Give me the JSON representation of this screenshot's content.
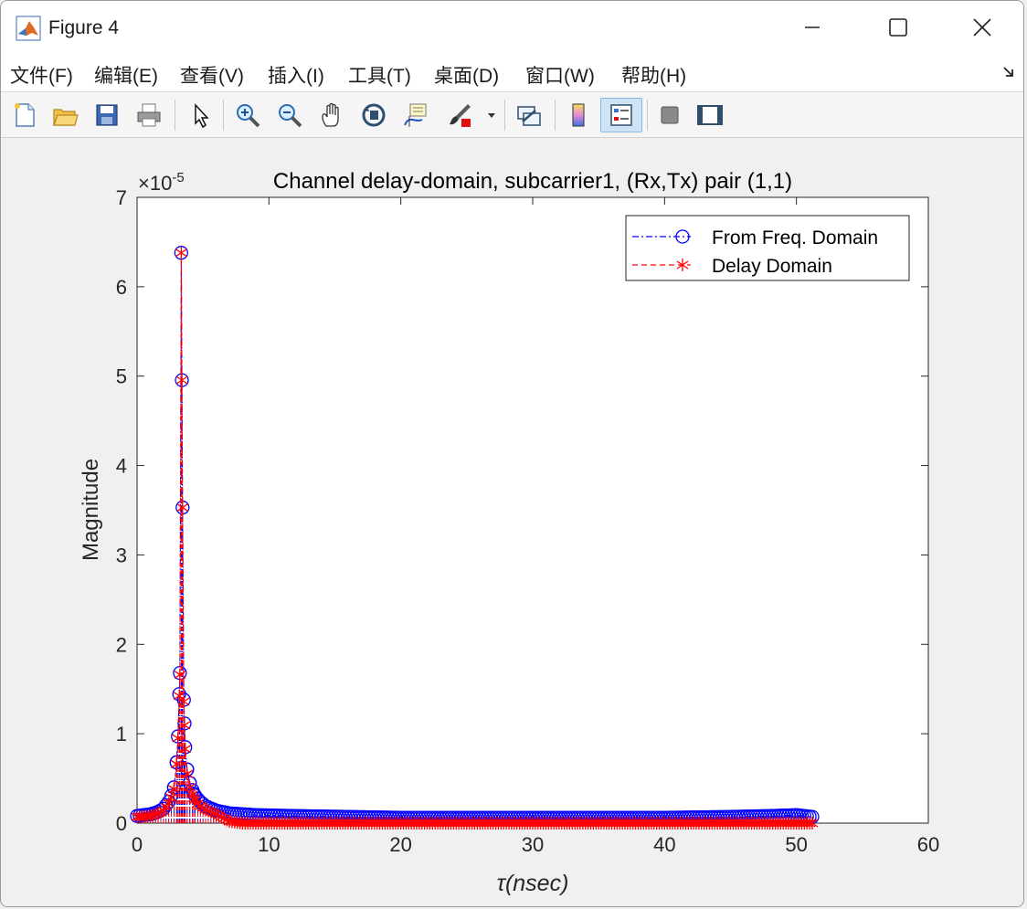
{
  "window": {
    "title": "Figure 4"
  },
  "menu": {
    "items": [
      {
        "label": "文件(F)",
        "name": "menu-file"
      },
      {
        "label": "编辑(E)",
        "name": "menu-edit"
      },
      {
        "label": "查看(V)",
        "name": "menu-view"
      },
      {
        "label": "插入(I)",
        "name": "menu-insert"
      },
      {
        "label": "工具(T)",
        "name": "menu-tools"
      },
      {
        "label": "桌面(D)",
        "name": "menu-desktop"
      },
      {
        "label": "窗口(W)",
        "name": "menu-window"
      },
      {
        "label": "帮助(H)",
        "name": "menu-help"
      }
    ]
  },
  "toolbar": {
    "icons": [
      "new-figure-icon",
      "open-file-icon",
      "save-icon",
      "print-icon",
      "select-arrow-icon",
      "zoom-in-icon",
      "zoom-out-icon",
      "pan-hand-icon",
      "rotate-3d-icon",
      "data-cursor-icon",
      "brush-icon",
      "brush-dropdown-icon",
      "link-plot-icon",
      "colorbar-icon",
      "legend-icon",
      "hide-plot-tools-icon",
      "show-plot-tools-icon"
    ]
  },
  "chart_data": {
    "type": "line",
    "title": "Channel delay-domain, subcarrier1, (Rx,Tx) pair (1,1)",
    "exponent_label": "×10",
    "exponent_power": "-5",
    "xlabel": "τ(nsec)",
    "ylabel": "Magnitude",
    "xlim": [
      0,
      60
    ],
    "ylim": [
      0,
      7
    ],
    "xticks": [
      "0",
      "10",
      "20",
      "30",
      "40",
      "50",
      "60"
    ],
    "yticks": [
      "0",
      "1",
      "2",
      "3",
      "4",
      "5",
      "6",
      "7"
    ],
    "legend_position": "top-right",
    "series": [
      {
        "name": "From Freq. Domain",
        "color": "#0000ff",
        "linestyle": "dash-dot",
        "marker": "circle",
        "points": [
          [
            0,
            0.08
          ],
          [
            0.5,
            0.09
          ],
          [
            1,
            0.1
          ],
          [
            1.5,
            0.12
          ],
          [
            2,
            0.16
          ],
          [
            2.5,
            0.26
          ],
          [
            2.8,
            0.4
          ],
          [
            3.0,
            0.68
          ],
          [
            3.1,
            0.97
          ],
          [
            3.25,
            1.68
          ],
          [
            3.35,
            6.38
          ],
          [
            3.45,
            3.53
          ],
          [
            3.55,
            1.38
          ],
          [
            3.65,
            0.85
          ],
          [
            3.8,
            0.6
          ],
          [
            4.0,
            0.45
          ],
          [
            4.3,
            0.33
          ],
          [
            4.7,
            0.25
          ],
          [
            5.2,
            0.19
          ],
          [
            6,
            0.14
          ],
          [
            7,
            0.11
          ],
          [
            9,
            0.09
          ],
          [
            12,
            0.08
          ],
          [
            16,
            0.07
          ],
          [
            20,
            0.06
          ],
          [
            25,
            0.06
          ],
          [
            30,
            0.06
          ],
          [
            35,
            0.06
          ],
          [
            40,
            0.06
          ],
          [
            45,
            0.07
          ],
          [
            48,
            0.08
          ],
          [
            50,
            0.09
          ],
          [
            51.2,
            0.07
          ]
        ]
      },
      {
        "name": "Delay Domain",
        "color": "#ff0000",
        "linestyle": "dashed",
        "marker": "asterisk",
        "points": [
          [
            0,
            0.07
          ],
          [
            0.5,
            0.07
          ],
          [
            1,
            0.08
          ],
          [
            1.5,
            0.1
          ],
          [
            2,
            0.14
          ],
          [
            2.5,
            0.24
          ],
          [
            2.8,
            0.38
          ],
          [
            3.0,
            0.66
          ],
          [
            3.1,
            0.95
          ],
          [
            3.25,
            1.66
          ],
          [
            3.35,
            6.38
          ],
          [
            3.45,
            3.53
          ],
          [
            3.55,
            1.36
          ],
          [
            3.65,
            0.83
          ],
          [
            3.8,
            0.55
          ],
          [
            4.0,
            0.4
          ],
          [
            4.3,
            0.28
          ],
          [
            4.7,
            0.2
          ],
          [
            5.2,
            0.15
          ],
          [
            6,
            0.1
          ],
          [
            7,
            0.02
          ],
          [
            8,
            0.0
          ],
          [
            10,
            0.0
          ],
          [
            15,
            0.0
          ],
          [
            20,
            0.0
          ],
          [
            25,
            0.0
          ],
          [
            30,
            0.0
          ],
          [
            35,
            0.0
          ],
          [
            40,
            0.0
          ],
          [
            45,
            0.0
          ],
          [
            50,
            0.0
          ],
          [
            51.2,
            0.0
          ]
        ]
      }
    ]
  }
}
